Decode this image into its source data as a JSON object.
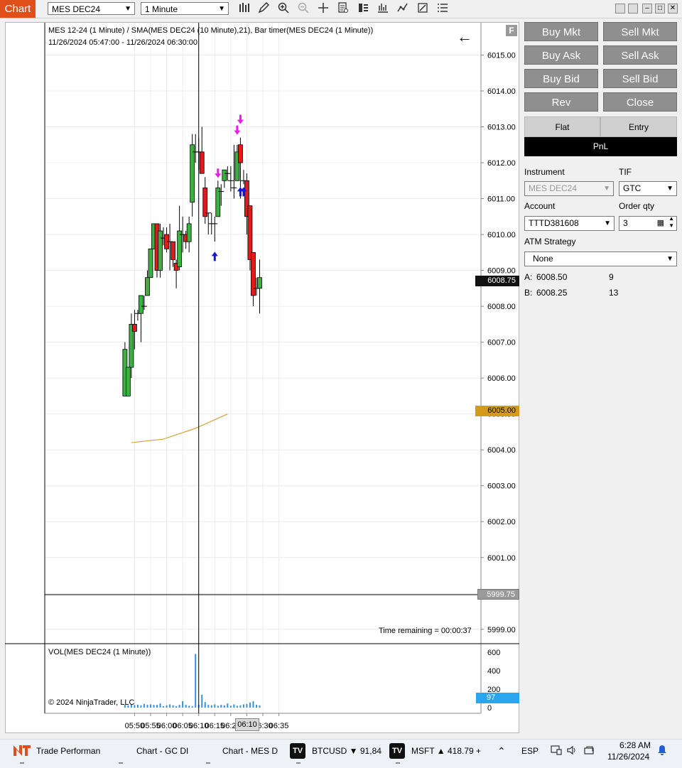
{
  "window": {
    "tab_label": "Chart",
    "instrument_select": "MES DEC24",
    "interval_select": "1 Minute"
  },
  "chart": {
    "header_line1": "MES 12-24 (1 Minute) / SMA(MES DEC24 (10 Minute),21), Bar timer(MES DEC24 (1 Minute))",
    "header_line2": "11/26/2024 05:47:00 - 11/26/2024 06:30:00",
    "f_button": "F",
    "back_arrow": "←",
    "time_remaining": "Time remaining = 00:00:37",
    "volume_label": "VOL(MES DEC24 (1 Minute))",
    "copyright": "© 2024 NinjaTrader, LLC",
    "current_price_marker": "6008.75",
    "sma_price_marker": "6005.00",
    "bottom_price_marker": "5999.75",
    "volume_marker": "97",
    "crosshair_time_label": "06:10",
    "price_colors": {
      "up": "#3cb043",
      "down": "#e01b1b",
      "sma": "#d4a33a",
      "volume": "#3a8fe0",
      "marker_current": "#111111",
      "marker_sma": "#d49a1e",
      "marker_volume": "#2aa6f0"
    }
  },
  "chart_data": {
    "type": "candlestick",
    "title": "MES 12-24 (1 Minute)",
    "price_axis_ticks": [
      "6015.00",
      "6014.00",
      "6013.00",
      "6012.00",
      "6011.00",
      "6010.00",
      "6009.00",
      "6008.00",
      "6007.00",
      "6006.00",
      "6005.00",
      "6004.00",
      "6003.00",
      "6002.00",
      "6001.00",
      "6000.00",
      "5999.00"
    ],
    "price_range": [
      5998.6,
      6015.9
    ],
    "volume_axis_ticks": [
      "600",
      "400",
      "200",
      "0"
    ],
    "volume_range": [
      0,
      660
    ],
    "time_axis_ticks": [
      "05:50",
      "05:55",
      "06:00",
      "06:05",
      "06:10",
      "06:15",
      "06:20",
      "06:25",
      "06:30",
      "06:35"
    ],
    "time_range_minutes": [
      322,
      458
    ],
    "candles": [
      {
        "t": 347,
        "o": 6005.5,
        "h": 6007.0,
        "l": 6005.5,
        "c": 6006.8
      },
      {
        "t": 348,
        "o": 6005.5,
        "h": 6006.3,
        "l": 6005.5,
        "c": 6006.3
      },
      {
        "t": 349,
        "o": 6006.3,
        "h": 6007.8,
        "l": 6006.0,
        "c": 6007.5
      },
      {
        "t": 350,
        "o": 6007.5,
        "h": 6007.9,
        "l": 6006.8,
        "c": 6007.3
      },
      {
        "t": 351,
        "o": 6007.8,
        "h": 6007.9,
        "l": 6007.6,
        "c": 6007.8
      },
      {
        "t": 352,
        "o": 6007.8,
        "h": 6008.2,
        "l": 6007.0,
        "c": 6008.3
      },
      {
        "t": 353,
        "o": 6008.0,
        "h": 6008.3,
        "l": 6007.9,
        "c": 6008.0
      },
      {
        "t": 354,
        "o": 6008.3,
        "h": 6009.0,
        "l": 6008.3,
        "c": 6008.8
      },
      {
        "t": 355,
        "o": 6008.8,
        "h": 6009.6,
        "l": 6008.8,
        "c": 6009.6
      },
      {
        "t": 356,
        "o": 6009.6,
        "h": 6010.3,
        "l": 6009.6,
        "c": 6010.3
      },
      {
        "t": 357,
        "o": 6010.3,
        "h": 6010.3,
        "l": 6008.8,
        "c": 6009.0
      },
      {
        "t": 358,
        "o": 6009.0,
        "h": 6010.3,
        "l": 6008.8,
        "c": 6010.1
      },
      {
        "t": 359,
        "o": 6009.9,
        "h": 6010.2,
        "l": 6009.7,
        "c": 6009.9
      },
      {
        "t": 360,
        "o": 6010.0,
        "h": 6010.2,
        "l": 6009.5,
        "c": 6009.6
      },
      {
        "t": 361,
        "o": 6009.8,
        "h": 6010.3,
        "l": 6009.0,
        "c": 6009.8
      },
      {
        "t": 362,
        "o": 6009.8,
        "h": 6009.8,
        "l": 6009.1,
        "c": 6009.3
      },
      {
        "t": 363,
        "o": 6009.2,
        "h": 6009.3,
        "l": 6008.5,
        "c": 6009.0
      },
      {
        "t": 364,
        "o": 6009.1,
        "h": 6010.8,
        "l": 6009.0,
        "c": 6010.1
      },
      {
        "t": 365,
        "o": 6010.0,
        "h": 6010.5,
        "l": 6009.5,
        "c": 6010.0
      },
      {
        "t": 366,
        "o": 6010.0,
        "h": 6010.1,
        "l": 6009.6,
        "c": 6009.8
      },
      {
        "t": 367,
        "o": 6009.8,
        "h": 6010.5,
        "l": 6009.5,
        "c": 6010.3
      },
      {
        "t": 368,
        "o": 6010.9,
        "h": 6012.8,
        "l": 6010.5,
        "c": 6012.5
      },
      {
        "t": 369,
        "o": 6012.3,
        "h": 6012.8,
        "l": 6012.0,
        "c": 6012.3
      },
      {
        "t": 370,
        "o": 6012.3,
        "h": 6012.7,
        "l": 6011.8,
        "c": 6012.3
      },
      {
        "t": 371,
        "o": 6012.3,
        "h": 6013.0,
        "l": 6011.8,
        "c": 6011.7
      },
      {
        "t": 372,
        "o": 6011.3,
        "h": 6011.6,
        "l": 6010.3,
        "c": 6010.5
      },
      {
        "t": 373,
        "o": 6010.6,
        "h": 6010.6,
        "l": 6010.0,
        "c": 6010.6
      },
      {
        "t": 374,
        "o": 6010.3,
        "h": 6010.6,
        "l": 6010.0,
        "c": 6010.3
      },
      {
        "t": 375,
        "o": 6010.3,
        "h": 6010.5,
        "l": 6009.8,
        "c": 6010.3
      },
      {
        "t": 376,
        "o": 6010.5,
        "h": 6011.5,
        "l": 6010.5,
        "c": 6011.3
      },
      {
        "t": 377,
        "o": 6011.2,
        "h": 6011.4,
        "l": 6010.8,
        "c": 6011.2
      },
      {
        "t": 378,
        "o": 6011.5,
        "h": 6011.8,
        "l": 6011.3,
        "c": 6011.8
      },
      {
        "t": 379,
        "o": 6011.7,
        "h": 6011.9,
        "l": 6011.5,
        "c": 6011.7
      },
      {
        "t": 380,
        "o": 6011.5,
        "h": 6011.9,
        "l": 6011.2,
        "c": 6011.5
      },
      {
        "t": 381,
        "o": 6011.3,
        "h": 6012.5,
        "l": 6011.0,
        "c": 6011.3
      },
      {
        "t": 382,
        "o": 6011.5,
        "h": 6012.5,
        "l": 6011.5,
        "c": 6012.3
      },
      {
        "t": 383,
        "o": 6012.5,
        "h": 6012.7,
        "l": 6011.0,
        "c": 6012.0
      },
      {
        "t": 384,
        "o": 6011.5,
        "h": 6011.8,
        "l": 6011.4,
        "c": 6011.5
      },
      {
        "t": 385,
        "o": 6011.5,
        "h": 6011.7,
        "l": 6010.0,
        "c": 6010.5
      },
      {
        "t": 386,
        "o": 6010.8,
        "h": 6010.8,
        "l": 6009.0,
        "c": 6009.3
      },
      {
        "t": 387,
        "o": 6009.5,
        "h": 6009.5,
        "l": 6008.0,
        "c": 6008.3
      },
      {
        "t": 388,
        "o": 6008.5,
        "h": 6008.8,
        "l": 6008.3,
        "c": 6008.5
      },
      {
        "t": 389,
        "o": 6008.5,
        "h": 6009.3,
        "l": 6007.8,
        "c": 6008.8
      }
    ],
    "volume": [
      {
        "t": 347,
        "v": 30
      },
      {
        "t": 348,
        "v": 25
      },
      {
        "t": 349,
        "v": 35
      },
      {
        "t": 350,
        "v": 28
      },
      {
        "t": 351,
        "v": 32
      },
      {
        "t": 352,
        "v": 25
      },
      {
        "t": 353,
        "v": 40
      },
      {
        "t": 354,
        "v": 30
      },
      {
        "t": 355,
        "v": 35
      },
      {
        "t": 356,
        "v": 30
      },
      {
        "t": 357,
        "v": 30
      },
      {
        "t": 358,
        "v": 45
      },
      {
        "t": 359,
        "v": 15
      },
      {
        "t": 360,
        "v": 25
      },
      {
        "t": 361,
        "v": 35
      },
      {
        "t": 362,
        "v": 25
      },
      {
        "t": 363,
        "v": 15
      },
      {
        "t": 364,
        "v": 30
      },
      {
        "t": 365,
        "v": 70
      },
      {
        "t": 366,
        "v": 30
      },
      {
        "t": 367,
        "v": 20
      },
      {
        "t": 368,
        "v": 15
      },
      {
        "t": 369,
        "v": 580
      },
      {
        "t": 370,
        "v": 30
      },
      {
        "t": 371,
        "v": 140
      },
      {
        "t": 372,
        "v": 60
      },
      {
        "t": 373,
        "v": 30
      },
      {
        "t": 374,
        "v": 25
      },
      {
        "t": 375,
        "v": 35
      },
      {
        "t": 376,
        "v": 20
      },
      {
        "t": 377,
        "v": 30
      },
      {
        "t": 378,
        "v": 25
      },
      {
        "t": 379,
        "v": 45
      },
      {
        "t": 380,
        "v": 20
      },
      {
        "t": 381,
        "v": 35
      },
      {
        "t": 382,
        "v": 20
      },
      {
        "t": 383,
        "v": 25
      },
      {
        "t": 384,
        "v": 35
      },
      {
        "t": 385,
        "v": 40
      },
      {
        "t": 386,
        "v": 55
      },
      {
        "t": 387,
        "v": 70
      },
      {
        "t": 388,
        "v": 30
      },
      {
        "t": 389,
        "v": 25
      }
    ],
    "sma": [
      {
        "t": 349,
        "v": 6004.2
      },
      {
        "t": 359,
        "v": 6004.3
      },
      {
        "t": 369,
        "v": 6004.6
      },
      {
        "t": 379,
        "v": 6005.0
      }
    ],
    "crosshair_time": 370,
    "arrows": [
      {
        "t": 376,
        "price": 6011.6,
        "dir": "down",
        "color": "#e61ee6"
      },
      {
        "t": 382,
        "price": 6012.8,
        "dir": "down",
        "color": "#e61ee6"
      },
      {
        "t": 383,
        "price": 6013.1,
        "dir": "down",
        "color": "#e61ee6"
      },
      {
        "t": 375,
        "price": 6009.5,
        "dir": "up",
        "color": "#1515e0"
      },
      {
        "t": 383,
        "price": 6011.3,
        "dir": "up",
        "color": "#1515e0"
      },
      {
        "t": 384,
        "price": 6011.3,
        "dir": "up",
        "color": "#1515e0"
      }
    ]
  },
  "order_panel": {
    "buttons": [
      "Buy Mkt",
      "Sell Mkt",
      "Buy Ask",
      "Sell Ask",
      "Buy Bid",
      "Sell Bid",
      "Rev",
      "Close"
    ],
    "flat_label": "Flat",
    "entry_label": "Entry",
    "pnl_label": "PnL",
    "instrument_label": "Instrument",
    "instrument_value": "MES DEC24",
    "tif_label": "TIF",
    "tif_value": "GTC",
    "account_label": "Account",
    "account_value": "TTTD381608",
    "qty_label": "Order qty",
    "qty_value": "3",
    "atm_label": "ATM Strategy",
    "atm_value": "None",
    "ask_label": "A:",
    "ask_price": "6008.50",
    "ask_size": "9",
    "bid_label": "B:",
    "bid_price": "6008.25",
    "bid_size": "13"
  },
  "taskbar": {
    "item1": "Trade Performan",
    "item2": "Chart - GC DI",
    "item3": "Chart - MES D",
    "ticker1": "BTCUSD ▼ 91,84",
    "ticker2": "MSFT ▲ 418.79 +",
    "language": "ESP",
    "time": "6:28 AM",
    "date": "11/26/2024",
    "tv_logo": "TV"
  }
}
